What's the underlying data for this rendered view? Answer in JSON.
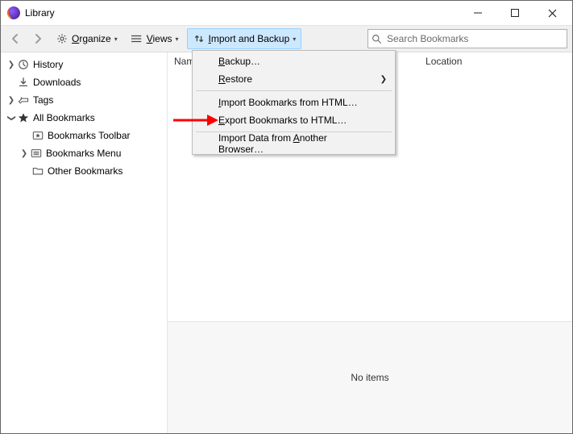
{
  "window": {
    "title": "Library"
  },
  "toolbar": {
    "organize": "Organize",
    "views": "Views",
    "import_backup": "Import and Backup"
  },
  "search": {
    "placeholder": "Search Bookmarks"
  },
  "sidebar": {
    "history": "History",
    "downloads": "Downloads",
    "tags": "Tags",
    "all_bookmarks": "All Bookmarks",
    "bookmarks_toolbar": "Bookmarks Toolbar",
    "bookmarks_menu": "Bookmarks Menu",
    "other_bookmarks": "Other Bookmarks"
  },
  "columns": {
    "name": "Name",
    "location": "Location"
  },
  "detail": {
    "no_items": "No items"
  },
  "menu": {
    "backup": "Backup…",
    "restore": "Restore",
    "import_html": "Import Bookmarks from HTML…",
    "export_html": "Export Bookmarks to HTML…",
    "import_other": "Import Data from Another Browser…"
  }
}
